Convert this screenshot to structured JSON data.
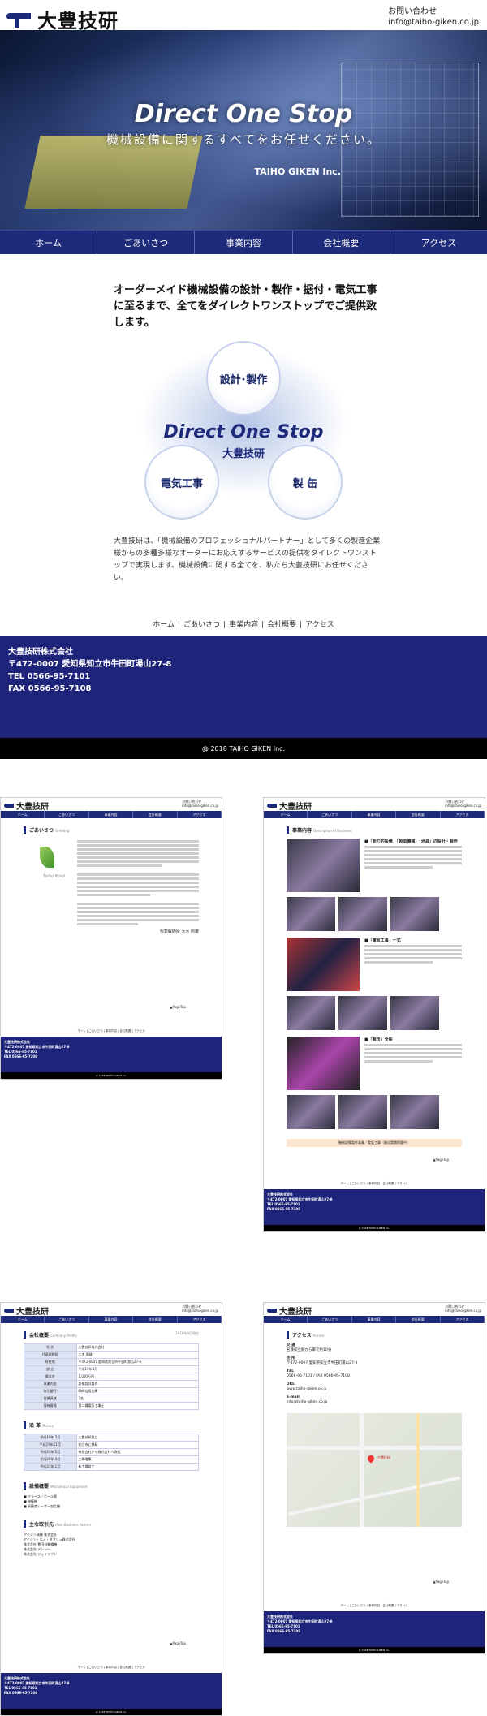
{
  "brand": {
    "name": "大豊技研",
    "contact_title": "お問い合わせ",
    "email": "info@taiho-giken.co.jp"
  },
  "hero": {
    "title": "Direct One Stop",
    "subtitle": "機械設備に関するすべてをお任せください。",
    "company": "TAIHO GIKEN Inc."
  },
  "nav": [
    "ホーム",
    "ごあいさつ",
    "事業内容",
    "会社概要",
    "アクセス"
  ],
  "lead": "オーダーメイド機械設備の設計・製作・据付・電気工事に至るまで、全てをダイレクトワンストップでご提供致します。",
  "circles": {
    "top": "設計･製作",
    "left": "電気工事",
    "right": "製 缶"
  },
  "center": {
    "title": "Direct One Stop",
    "sub": "大豊技研"
  },
  "paragraph": "大豊技研は、「機械設備のプロフェッショナルパートナー」として多くの製造企業様からの多種多様なオーダーにお応えするサービスの提供をダイレクトワンストップで実現します。機械設備に関する全てを、私たち大豊技研にお任せください。",
  "footer_nav": [
    "ホーム",
    "ごあいさつ",
    "事業内容",
    "会社概要",
    "アクセス"
  ],
  "footer": {
    "company": "大豊技研株式会社",
    "address": "〒472-0007 愛知県知立市牛田町湯山27-8",
    "tel": "TEL 0566-95-7101",
    "fax": "FAX 0566-95-7108"
  },
  "copyright": "@ 2018 TAIHO GIKEN Inc.",
  "thumbs": {
    "greeting": {
      "title": "ごあいさつ",
      "en": "Greeting",
      "signature": "代表取締役 大木 照雄",
      "mark": "Taiho Mind"
    },
    "business": {
      "title": "事業内容",
      "en": "Description of Business",
      "items": [
        "■「能力的設備」「製造機械」「治具」の設計・製作",
        "■「電気工事」一式",
        "■「製缶」全般"
      ],
      "banner": "機械設備製作事業／電気工事（最近実績掲載中）"
    },
    "company": {
      "title": "会社概要",
      "en": "Company Profile",
      "date": "2018年4月現在",
      "rows": [
        [
          "社 名",
          "大豊技研株式会社"
        ],
        [
          "代表取締役",
          "大木 照雄"
        ],
        [
          "所在地",
          "〒472-0007 愛知県知立市牛田町湯山27-8"
        ],
        [
          "設 立",
          "平成19年3月"
        ],
        [
          "資本金",
          "1,000万円"
        ],
        [
          "事業内容",
          "設備設計製作"
        ],
        [
          "取引銀行",
          "岡崎信用金庫"
        ],
        [
          "従業員数",
          "7名"
        ],
        [
          "保有資格",
          "第二種電気工事士"
        ]
      ],
      "history_title": "沿 革",
      "history_en": "History",
      "history": [
        [
          "平成19年 3月",
          "大豊技研設立"
        ],
        [
          "平成19年11月",
          "知立市に移転"
        ],
        [
          "平成24年 5月",
          "有限会社から株式会社へ改組"
        ],
        [
          "平成28年 4月",
          "工場増築"
        ],
        [
          "平成31年 1月",
          "新工場竣工"
        ]
      ],
      "equip_title": "設備概要",
      "equip_en": "Mechanical Equipment",
      "equip": [
        "■ フライス／ボール盤",
        "■ 溶接機",
        "■ 高精度レーザー加工機"
      ],
      "partner_title": "主な取引先",
      "partner_en": "Main Business Partner",
      "partners": [
        "アイシン精機 株式会社",
        "アイシン・エィ・ダブリュ株式会社",
        "株式会社 豊田自動織機",
        "株式会社 デンソー",
        "株式会社 ジェイテクト"
      ]
    },
    "access": {
      "title": "アクセス",
      "en": "Access",
      "rows": [
        [
          "交 通",
          "名鉄知立駅から車で約10分"
        ],
        [
          "住 所",
          "〒472-0007 愛知県知立市牛田町湯山27-8"
        ],
        [
          "TEL",
          "0566-95-7101 / FAX 0566-95-7108"
        ],
        [
          "URL",
          "www.taiho-giken.co.jp"
        ],
        [
          "E-mail",
          "info@taiho-giken.co.jp"
        ]
      ],
      "map_label": "大豊技研"
    },
    "pagetop": "▲PageTop"
  }
}
